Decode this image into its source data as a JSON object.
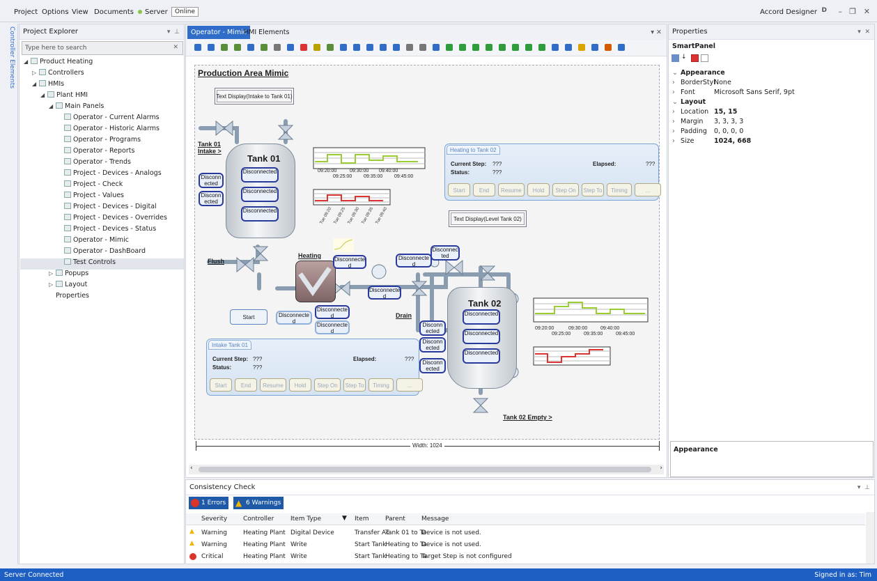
{
  "menu": {
    "items": [
      "Project",
      "Options",
      "View",
      "Documents",
      "Server"
    ],
    "online": "Online",
    "app_name": "Accord Designer",
    "user_badge": "D"
  },
  "side_tab": "Controller Elements",
  "explorer": {
    "title": "Project Explorer",
    "search_placeholder": "Type here to search",
    "tree": [
      {
        "label": "Product Heating",
        "depth": 0,
        "arrow": "◢"
      },
      {
        "label": "Controllers",
        "depth": 1,
        "arrow": "▷"
      },
      {
        "label": "HMIs",
        "depth": 1,
        "arrow": "◢"
      },
      {
        "label": "Plant HMI",
        "depth": 2,
        "arrow": "◢"
      },
      {
        "label": "Main Panels",
        "depth": 3,
        "arrow": "◢"
      },
      {
        "label": "Operator - Current Alarms",
        "depth": 4,
        "arrow": ""
      },
      {
        "label": "Operator - Historic Alarms",
        "depth": 4,
        "arrow": ""
      },
      {
        "label": "Operator - Programs",
        "depth": 4,
        "arrow": ""
      },
      {
        "label": "Operator - Reports",
        "depth": 4,
        "arrow": ""
      },
      {
        "label": "Operator - Trends",
        "depth": 4,
        "arrow": ""
      },
      {
        "label": "Project - Devices - Analogs",
        "depth": 4,
        "arrow": ""
      },
      {
        "label": "Project - Check",
        "depth": 4,
        "arrow": ""
      },
      {
        "label": "Project - Values",
        "depth": 4,
        "arrow": ""
      },
      {
        "label": "Project - Devices - Digital",
        "depth": 4,
        "arrow": ""
      },
      {
        "label": "Project - Devices - Overrides",
        "depth": 4,
        "arrow": ""
      },
      {
        "label": "Project - Devices - Status",
        "depth": 4,
        "arrow": ""
      },
      {
        "label": "Operator - Mimic",
        "depth": 4,
        "arrow": ""
      },
      {
        "label": "Operator - DashBoard",
        "depth": 4,
        "arrow": ""
      },
      {
        "label": "Test Controls",
        "depth": 4,
        "arrow": ""
      },
      {
        "label": "Popups",
        "depth": 3,
        "arrow": "▷"
      },
      {
        "label": "Layout",
        "depth": 3,
        "arrow": "▷"
      },
      {
        "label": "Properties",
        "depth": 3,
        "arrow": ""
      }
    ],
    "selected": "Operator - Mimic"
  },
  "doc": {
    "tabs": [
      "Operator - Mimic",
      "HMI Elements"
    ],
    "close": "▾  ✕",
    "mimic": {
      "title": "Production Area Mimic",
      "text_display_1": "Text Display(Intake to Tank 01)",
      "text_display_2": "Text Display(Level Tank 02)",
      "tank01": "Tank 01",
      "tank02": "Tank 02",
      "tank01_intake": "Tank 01 Intake >",
      "tank02_empty": "Tank 02 Empty >",
      "flush": "Flush",
      "heating": "Heating",
      "drain": "Drain",
      "start": "Start",
      "disconnected": "Disconnected",
      "disconnected_short": "Disconn ected",
      "disconnected_b": "Disconnecte d",
      "disconnected_c": "Disconnec ted",
      "panel_heating": {
        "title": "Heating to Tank 02",
        "current_step": "Current Step:",
        "step_val": "???",
        "status": "Status:",
        "status_val": "???",
        "elapsed": "Elapsed:",
        "elapsed_val": "???",
        "buttons": [
          "Start",
          "End",
          "Resume",
          "Hold",
          "Step On",
          "Step To",
          "Timing",
          "..."
        ]
      },
      "panel_intake": {
        "title": "Intake Tank 01",
        "current_step": "Current Step:",
        "step_val": "???",
        "status": "Status:",
        "status_val": "???",
        "elapsed": "Elapsed:",
        "elapsed_val": "???",
        "buttons": [
          "Start",
          "End",
          "Resume",
          "Hold",
          "Step On",
          "Step To",
          "Timing",
          "..."
        ]
      },
      "trend_times_top": [
        "09:20:00",
        "09:30:00",
        "09:40:00"
      ],
      "trend_times_bot": [
        "09:25:00",
        "09:35:00",
        "09:45:00"
      ],
      "width_label": "Width: 1024"
    }
  },
  "properties": {
    "title": "Properties",
    "object": "SmartPanel",
    "rows": [
      {
        "k": "Appearance",
        "v": "",
        "group": true
      },
      {
        "k": "BorderStyl",
        "v": "None"
      },
      {
        "k": "Font",
        "v": "Microsoft Sans Serif, 9pt"
      },
      {
        "k": "Layout",
        "v": "",
        "group": true
      },
      {
        "k": "Location",
        "v": "15, 15",
        "bold": true
      },
      {
        "k": "Margin",
        "v": "3, 3, 3, 3"
      },
      {
        "k": "Padding",
        "v": "0, 0, 0, 0"
      },
      {
        "k": "Size",
        "v": "1024, 668",
        "bold": true
      }
    ],
    "desc_title": "Appearance"
  },
  "consistency": {
    "title": "Consistency Check",
    "errors": "1 Errors",
    "warnings": "6 Warnings",
    "columns": [
      "Severity",
      "Controller",
      "Item Type",
      "Item",
      "Parent",
      "Message"
    ],
    "rows": [
      {
        "severity": "Warning",
        "controller": "Heating Plant",
        "item_type": "Digital Device",
        "item": "Transfer Ac",
        "parent": "Tank 01 to Ta",
        "message": "Device is not used."
      },
      {
        "severity": "Warning",
        "controller": "Heating Plant",
        "item_type": "Write",
        "item": "Start Tank",
        "parent": "Heating to Ta",
        "message": "Device is not used."
      },
      {
        "severity": "Critical",
        "controller": "Heating Plant",
        "item_type": "Write",
        "item": "Start Tank",
        "parent": "Heating to Ta",
        "message": "Target Step is not configured"
      }
    ]
  },
  "status": {
    "left": "Server Connected",
    "right": "Signed in as: Tim"
  },
  "colors": {
    "accent": "#1e5fc4",
    "tab_active": "#2f6dc8",
    "warning": "#f2b600",
    "critical": "#d9352a"
  }
}
